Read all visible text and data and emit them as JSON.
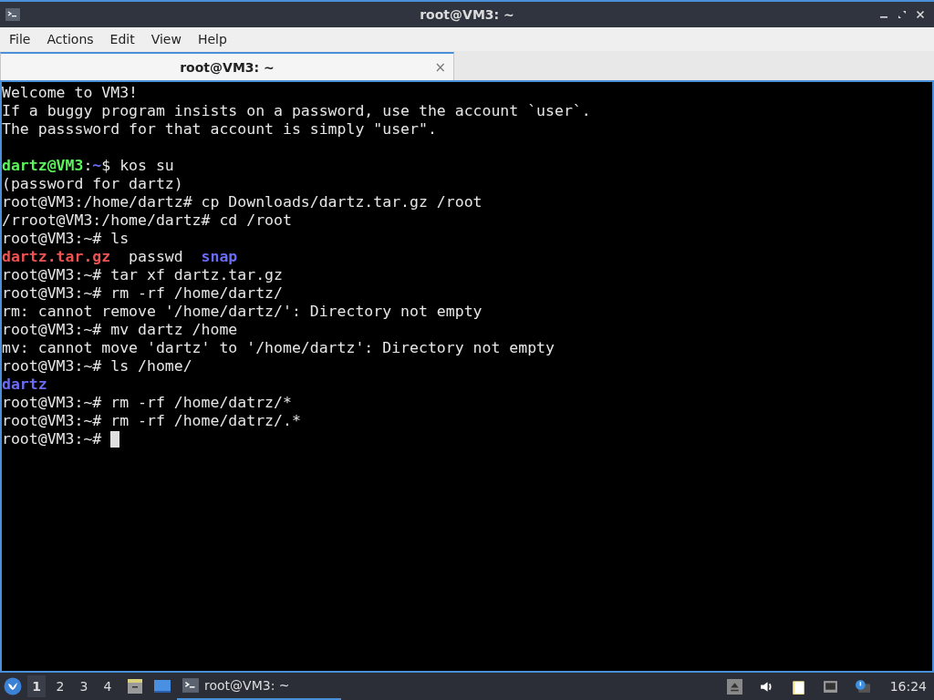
{
  "window": {
    "title": "root@VM3: ~"
  },
  "menu": [
    "File",
    "Actions",
    "Edit",
    "View",
    "Help"
  ],
  "tabs": [
    {
      "label": "root@VM3: ~",
      "selected": true,
      "close": "×"
    }
  ],
  "terminal": {
    "cursor": true,
    "lines": [
      {
        "segments": [
          {
            "kind": "plain",
            "text": "Welcome to VM3!"
          }
        ]
      },
      {
        "segments": [
          {
            "kind": "plain",
            "text": "If a buggy program insists on a password, use the account `user`."
          }
        ]
      },
      {
        "segments": [
          {
            "kind": "plain",
            "text": "The passsword for that account is simply \"user\"."
          }
        ]
      },
      {
        "kind": "blank"
      },
      {
        "segments": [
          {
            "kind": "user",
            "text": "dartz@VM3"
          },
          {
            "kind": "plain",
            "text": ":"
          },
          {
            "kind": "path",
            "text": "~"
          },
          {
            "kind": "plain",
            "text": "$ kos su"
          }
        ]
      },
      {
        "segments": [
          {
            "kind": "plain",
            "text": "(password for dartz)"
          }
        ]
      },
      {
        "segments": [
          {
            "kind": "plain",
            "text": "root@VM3:/home/dartz# cp Downloads/dartz.tar.gz /root"
          }
        ]
      },
      {
        "segments": [
          {
            "kind": "plain",
            "text": "/rroot@VM3:/home/dartz# cd /root"
          }
        ]
      },
      {
        "segments": [
          {
            "kind": "plain",
            "text": "root@VM3:~# ls"
          }
        ]
      },
      {
        "segments": [
          {
            "kind": "archive",
            "text": "dartz.tar.gz"
          },
          {
            "kind": "plain",
            "text": "  passwd  "
          },
          {
            "kind": "dir",
            "text": "snap"
          }
        ]
      },
      {
        "segments": [
          {
            "kind": "plain",
            "text": "root@VM3:~# tar xf dartz.tar.gz"
          }
        ]
      },
      {
        "segments": [
          {
            "kind": "plain",
            "text": "root@VM3:~# rm -rf /home/dartz/"
          }
        ]
      },
      {
        "segments": [
          {
            "kind": "plain",
            "text": "rm: cannot remove '/home/dartz/': Directory not empty"
          }
        ]
      },
      {
        "segments": [
          {
            "kind": "plain",
            "text": "root@VM3:~# mv dartz /home"
          }
        ]
      },
      {
        "segments": [
          {
            "kind": "plain",
            "text": "mv: cannot move 'dartz' to '/home/dartz': Directory not empty"
          }
        ]
      },
      {
        "segments": [
          {
            "kind": "plain",
            "text": "root@VM3:~# ls /home/"
          }
        ]
      },
      {
        "segments": [
          {
            "kind": "dir",
            "text": "dartz"
          }
        ]
      },
      {
        "segments": [
          {
            "kind": "plain",
            "text": "root@VM3:~# rm -rf /home/datrz/*"
          }
        ]
      },
      {
        "segments": [
          {
            "kind": "plain",
            "text": "root@VM3:~# rm -rf /home/datrz/.*"
          }
        ]
      },
      {
        "segments": [
          {
            "kind": "plain",
            "text": "root@VM3:~# "
          }
        ]
      }
    ]
  },
  "taskbar": {
    "workspaces": [
      {
        "label": "1",
        "selected": true
      },
      {
        "label": "2",
        "selected": false
      },
      {
        "label": "3",
        "selected": false
      },
      {
        "label": "4",
        "selected": false
      }
    ],
    "task": {
      "label": "root@VM3: ~",
      "selected": true
    },
    "clock": "16:24"
  }
}
